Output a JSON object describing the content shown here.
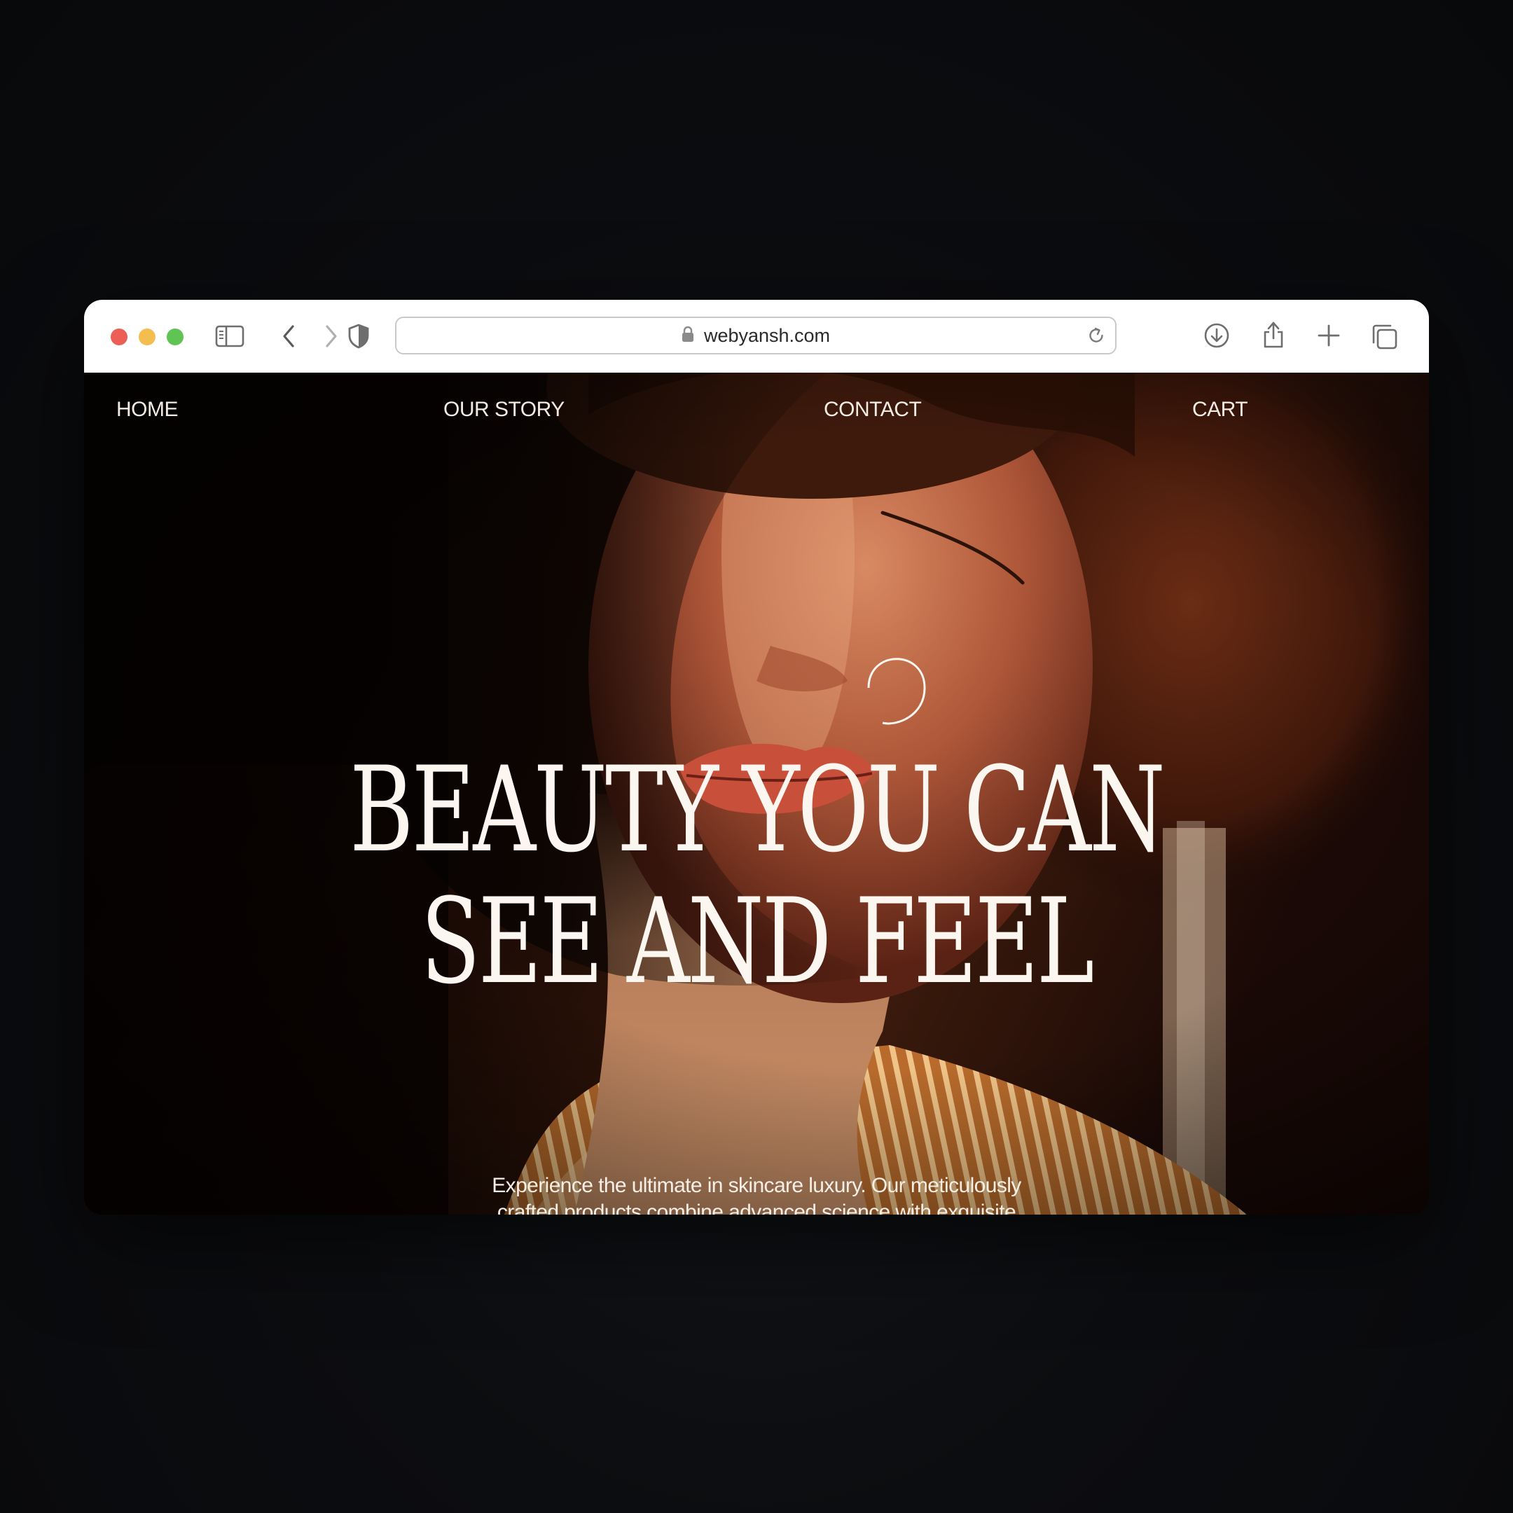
{
  "browser": {
    "url": "webyansh.com",
    "traffic_lights": {
      "close": "#ec5f56",
      "minimize": "#f4bd4f",
      "zoom": "#5fc453"
    },
    "icons": [
      "sidebar-icon",
      "back-icon",
      "forward-icon",
      "privacy-shield-icon",
      "lock-icon",
      "reload-icon",
      "download-icon",
      "share-icon",
      "new-tab-icon",
      "tabs-overview-icon"
    ]
  },
  "nav": {
    "home": "HOME",
    "our_story": "OUR STORY",
    "contact": "CONTACT",
    "cart": "CART"
  },
  "hero": {
    "headline_line1": "BEAUTY YOU CAN",
    "headline_line2": "SEE AND FEEL",
    "body": "Experience the ultimate in skincare luxury. Our meticulously crafted products combine advanced science with exquisite"
  }
}
